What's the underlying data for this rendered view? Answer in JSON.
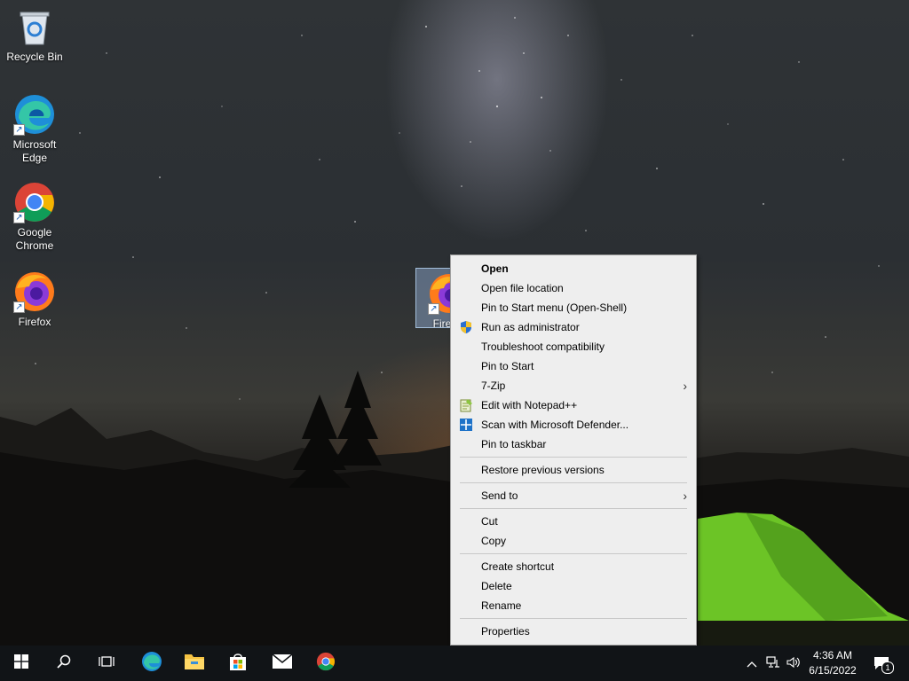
{
  "desktop": {
    "icons": [
      {
        "label": "Recycle Bin",
        "icon": "recycle-bin-icon"
      },
      {
        "label": "Microsoft Edge",
        "icon": "edge-icon"
      },
      {
        "label": "Google Chrome",
        "icon": "chrome-icon"
      },
      {
        "label": "Firefox",
        "icon": "firefox-icon"
      },
      {
        "label": "Firefox",
        "icon": "firefox-icon",
        "selected": true
      }
    ]
  },
  "context_menu": {
    "items": [
      {
        "label": "Open",
        "bold": true
      },
      {
        "label": "Open file location"
      },
      {
        "label": "Pin to Start menu (Open-Shell)"
      },
      {
        "label": "Run as administrator",
        "icon": "uac-shield-icon"
      },
      {
        "label": "Troubleshoot compatibility"
      },
      {
        "label": "Pin to Start"
      },
      {
        "label": "7-Zip",
        "submenu": true
      },
      {
        "label": "Edit with Notepad++",
        "icon": "notepadpp-icon"
      },
      {
        "label": "Scan with Microsoft Defender...",
        "icon": "defender-icon"
      },
      {
        "label": "Pin to taskbar"
      },
      {
        "label": "Restore previous versions"
      },
      {
        "label": "Send to",
        "submenu": true
      },
      {
        "label": "Cut"
      },
      {
        "label": "Copy"
      },
      {
        "label": "Create shortcut"
      },
      {
        "label": "Delete"
      },
      {
        "label": "Rename"
      },
      {
        "label": "Properties"
      }
    ]
  },
  "taskbar": {
    "buttons": [
      "start-icon",
      "search-icon",
      "task-view-icon",
      "edge-icon",
      "file-explorer-icon",
      "store-icon",
      "mail-icon",
      "chrome-icon"
    ],
    "tray": [
      "chevron-up-icon",
      "network-icon",
      "volume-icon"
    ],
    "clock": {
      "time": "4:36 AM",
      "date": "6/15/2022"
    },
    "notifications": {
      "icon": "action-center-icon",
      "count": "1"
    }
  }
}
